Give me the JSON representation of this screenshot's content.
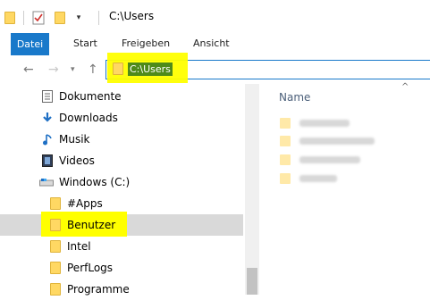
{
  "window": {
    "title": "C:\\Users"
  },
  "ribbon": {
    "file_tab": "Datei",
    "tabs": [
      "Start",
      "Freigeben",
      "Ansicht"
    ]
  },
  "address": {
    "path": "C:\\Users"
  },
  "nav": {
    "items": [
      {
        "label": "Dokumente",
        "icon": "documents-icon"
      },
      {
        "label": "Downloads",
        "icon": "downloads-icon"
      },
      {
        "label": "Musik",
        "icon": "music-icon"
      },
      {
        "label": "Videos",
        "icon": "videos-icon"
      },
      {
        "label": "Windows (C:)",
        "icon": "drive-icon"
      },
      {
        "label": "#Apps",
        "icon": "folder-icon"
      },
      {
        "label": "Benutzer",
        "icon": "folder-icon",
        "selected": true
      },
      {
        "label": "Intel",
        "icon": "folder-icon"
      },
      {
        "label": "PerfLogs",
        "icon": "folder-icon"
      },
      {
        "label": "Programme",
        "icon": "folder-icon"
      }
    ]
  },
  "content": {
    "column_name": "Name"
  },
  "colors": {
    "accent": "#1979ca",
    "highlight": "#ffff00",
    "selection": "#4e8a1a"
  }
}
